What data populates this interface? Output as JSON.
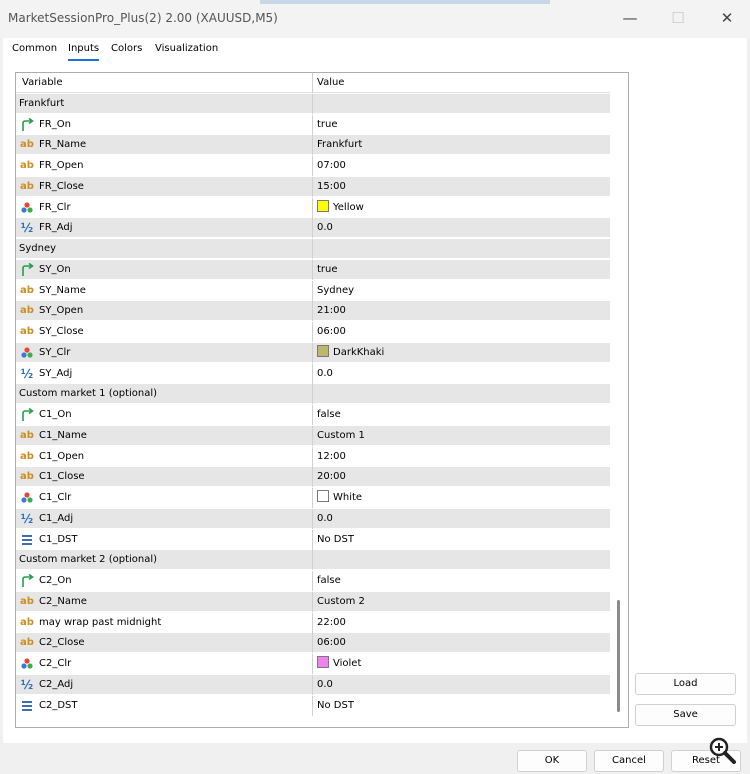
{
  "window": {
    "title": "MarketSessionPro_Plus(2) 2.00 (XAUUSD,M5)",
    "minimize_glyph": "—",
    "maximize_glyph": "☐",
    "close_glyph": "✕"
  },
  "tabs": [
    {
      "label": "Common",
      "active": false
    },
    {
      "label": "Inputs",
      "active": true
    },
    {
      "label": "Colors",
      "active": false
    },
    {
      "label": "Visualization",
      "active": false
    }
  ],
  "grid": {
    "headers": {
      "variable": "Variable",
      "value": "Value"
    },
    "rows": [
      {
        "type": "group",
        "variable": "Frankfurt",
        "value": ""
      },
      {
        "type": "bool",
        "icon": "bool-arrow-icon",
        "variable": "FR_On",
        "value": "true"
      },
      {
        "type": "string",
        "icon": "string-ab-icon",
        "variable": "FR_Name",
        "value": "Frankfurt"
      },
      {
        "type": "string",
        "icon": "string-ab-icon",
        "variable": "FR_Open",
        "value": "07:00"
      },
      {
        "type": "string",
        "icon": "string-ab-icon",
        "variable": "FR_Close",
        "value": "15:00"
      },
      {
        "type": "color",
        "icon": "color-palette-icon",
        "variable": "FR_Clr",
        "value": "Yellow",
        "swatch": "#ffff00"
      },
      {
        "type": "double",
        "icon": "fraction-half-icon",
        "variable": "FR_Adj",
        "value": "0.0"
      },
      {
        "type": "group",
        "variable": "Sydney",
        "value": ""
      },
      {
        "type": "bool",
        "icon": "bool-arrow-icon",
        "variable": "SY_On",
        "value": "true"
      },
      {
        "type": "string",
        "icon": "string-ab-icon",
        "variable": "SY_Name",
        "value": "Sydney"
      },
      {
        "type": "string",
        "icon": "string-ab-icon",
        "variable": "SY_Open",
        "value": "21:00"
      },
      {
        "type": "string",
        "icon": "string-ab-icon",
        "variable": "SY_Close",
        "value": "06:00"
      },
      {
        "type": "color",
        "icon": "color-palette-icon",
        "variable": "SY_Clr",
        "value": "DarkKhaki",
        "swatch": "#bdb76b"
      },
      {
        "type": "double",
        "icon": "fraction-half-icon",
        "variable": "SY_Adj",
        "value": "0.0"
      },
      {
        "type": "group",
        "variable": "Custom market 1 (optional)",
        "value": ""
      },
      {
        "type": "bool",
        "icon": "bool-arrow-icon",
        "variable": "C1_On",
        "value": "false"
      },
      {
        "type": "string",
        "icon": "string-ab-icon",
        "variable": "C1_Name",
        "value": "Custom 1"
      },
      {
        "type": "string",
        "icon": "string-ab-icon",
        "variable": "C1_Open",
        "value": "12:00"
      },
      {
        "type": "string",
        "icon": "string-ab-icon",
        "variable": "C1_Close",
        "value": "20:00"
      },
      {
        "type": "color",
        "icon": "color-palette-icon",
        "variable": "C1_Clr",
        "value": "White",
        "swatch": "#ffffff"
      },
      {
        "type": "double",
        "icon": "fraction-half-icon",
        "variable": "C1_Adj",
        "value": "0.0"
      },
      {
        "type": "enum",
        "icon": "enum-list-icon",
        "variable": "C1_DST",
        "value": "No DST"
      },
      {
        "type": "group",
        "variable": "Custom market 2 (optional)",
        "value": ""
      },
      {
        "type": "bool",
        "icon": "bool-arrow-icon",
        "variable": "C2_On",
        "value": "false"
      },
      {
        "type": "string",
        "icon": "string-ab-icon",
        "variable": "C2_Name",
        "value": "Custom 2"
      },
      {
        "type": "string",
        "icon": "string-ab-icon",
        "variable": "may wrap past midnight",
        "value": "22:00"
      },
      {
        "type": "string",
        "icon": "string-ab-icon",
        "variable": "C2_Close",
        "value": "06:00"
      },
      {
        "type": "color",
        "icon": "color-palette-icon",
        "variable": "C2_Clr",
        "value": "Violet",
        "swatch": "#ee82ee"
      },
      {
        "type": "double",
        "icon": "fraction-half-icon",
        "variable": "C2_Adj",
        "value": "0.0"
      },
      {
        "type": "enum",
        "icon": "enum-list-icon",
        "variable": "C2_DST",
        "value": "No DST"
      }
    ]
  },
  "side_buttons": {
    "load": "Load",
    "save": "Save"
  },
  "footer_buttons": {
    "ok": "OK",
    "cancel": "Cancel",
    "reset": "Reset"
  }
}
